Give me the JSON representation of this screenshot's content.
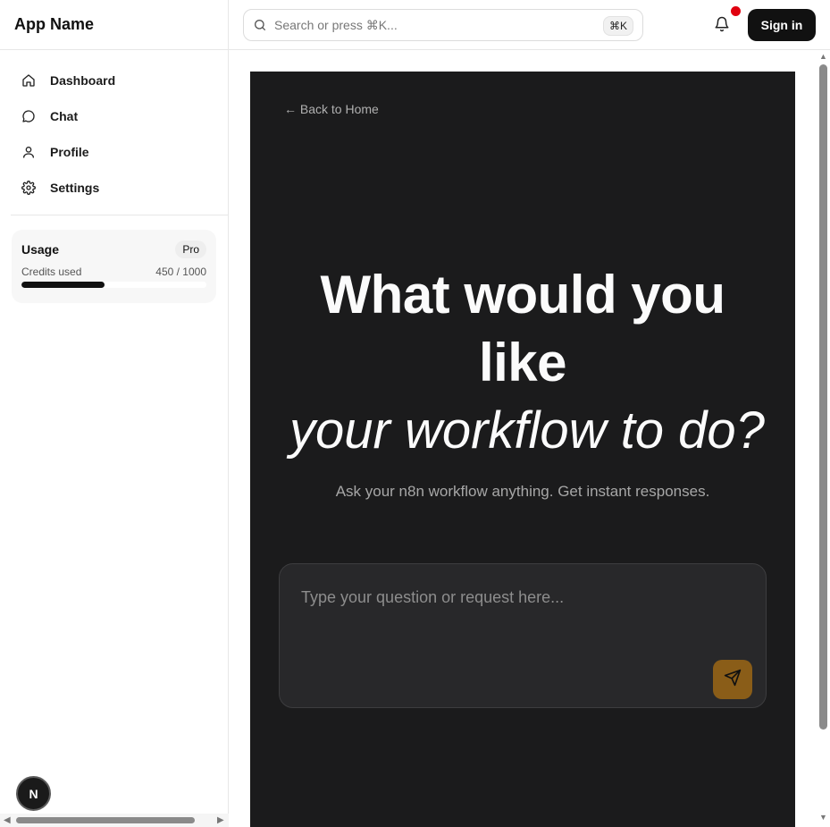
{
  "sidebar": {
    "brand": "App Name",
    "items": [
      {
        "label": "Dashboard",
        "icon": "home-icon"
      },
      {
        "label": "Chat",
        "icon": "chat-bubble-icon"
      },
      {
        "label": "Profile",
        "icon": "user-icon"
      },
      {
        "label": "Settings",
        "icon": "gear-icon"
      }
    ],
    "usage": {
      "title": "Usage",
      "plan": "Pro",
      "label": "Credits used",
      "value_text": "450 / 1000",
      "used": 450,
      "total": 1000
    },
    "badge_letter": "N"
  },
  "header": {
    "search_placeholder": "Search or press ⌘K...",
    "shortcut": "⌘K",
    "signin_label": "Sign in",
    "notification_dot_color": "#e0000f"
  },
  "main": {
    "back_label": "← Back to Home",
    "heading_line1": "What would you",
    "heading_line2": "like",
    "heading_line3": "your workflow to do?",
    "subtitle": "Ask your n8n workflow anything. Get instant responses.",
    "input_placeholder": "Type your question or request here...",
    "accent_color": "#8a5d18",
    "panel_color": "#1b1b1c"
  }
}
